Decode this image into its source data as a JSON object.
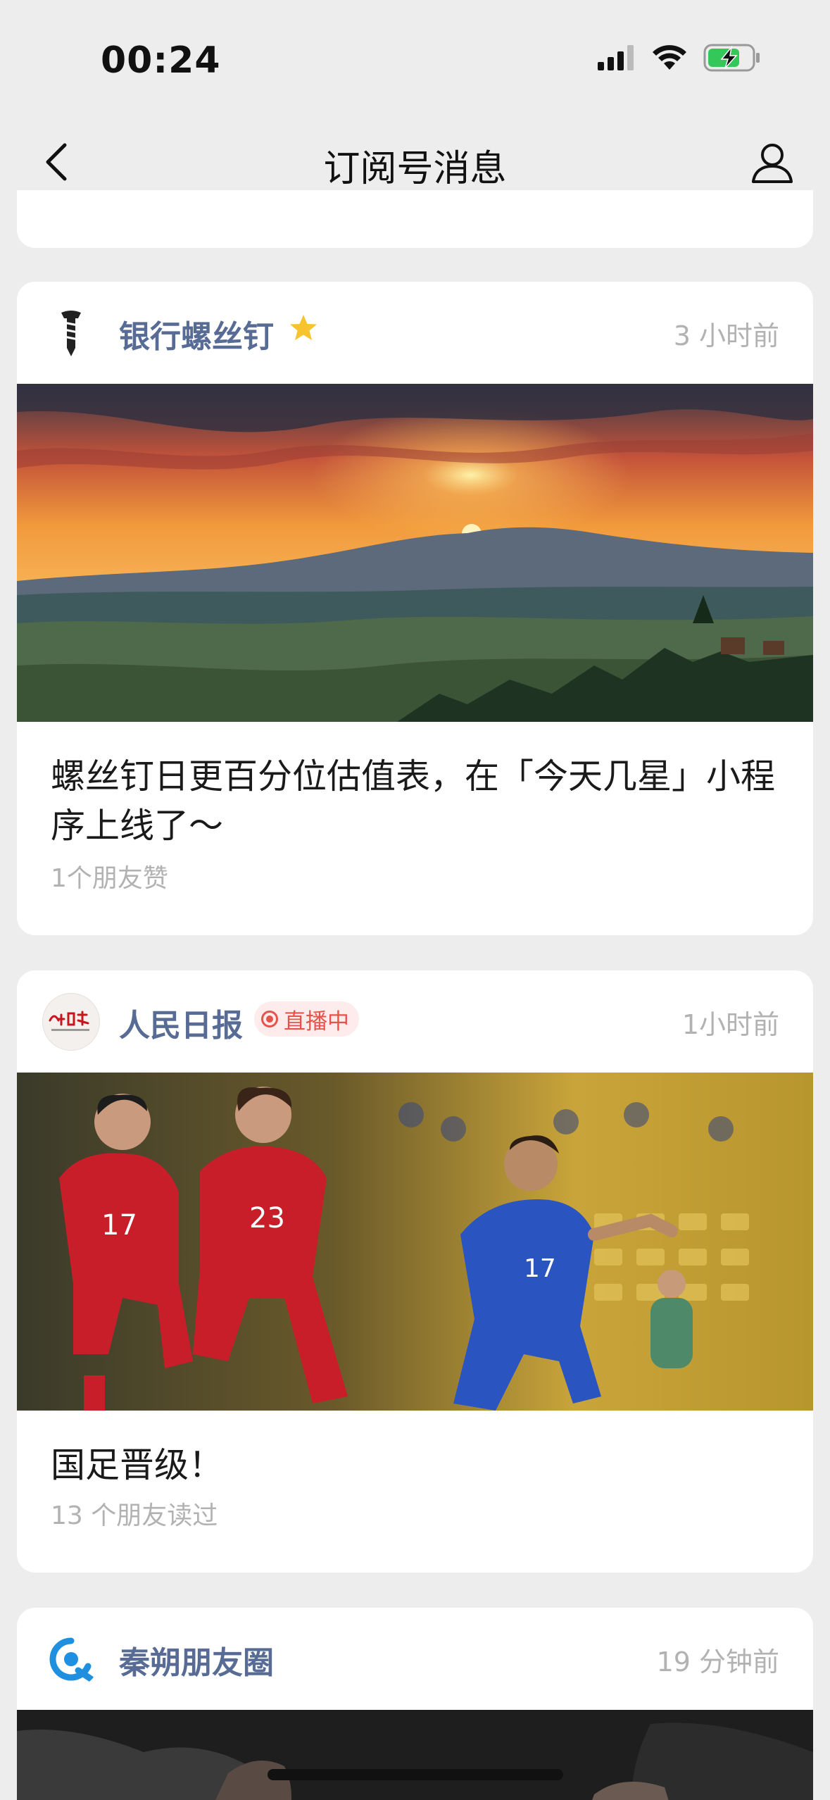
{
  "status_bar": {
    "time": "00:24"
  },
  "nav": {
    "title": "订阅号消息"
  },
  "articles": [
    {
      "account": "银行螺丝钉",
      "starred": true,
      "time": "3 小时前",
      "title": "螺丝钉日更百分位估值表，在「今天几星」小程序上线了～",
      "meta": "1个朋友赞",
      "cover": "sunset-mountain-landscape"
    },
    {
      "account": "人民日报",
      "live_badge": "直播中",
      "time": "1小时前",
      "title": "国足晋级！",
      "meta": "13 个朋友读过",
      "cover": "football-match-players"
    },
    {
      "account": "秦朔朋友圈",
      "time": "19 分钟前",
      "cover": "dark-hands-photo"
    }
  ],
  "colors": {
    "background": "#ededed",
    "account_name": "#576b95",
    "time": "#b2b2b2",
    "live": "#e5534b",
    "star": "#f7c32e"
  }
}
